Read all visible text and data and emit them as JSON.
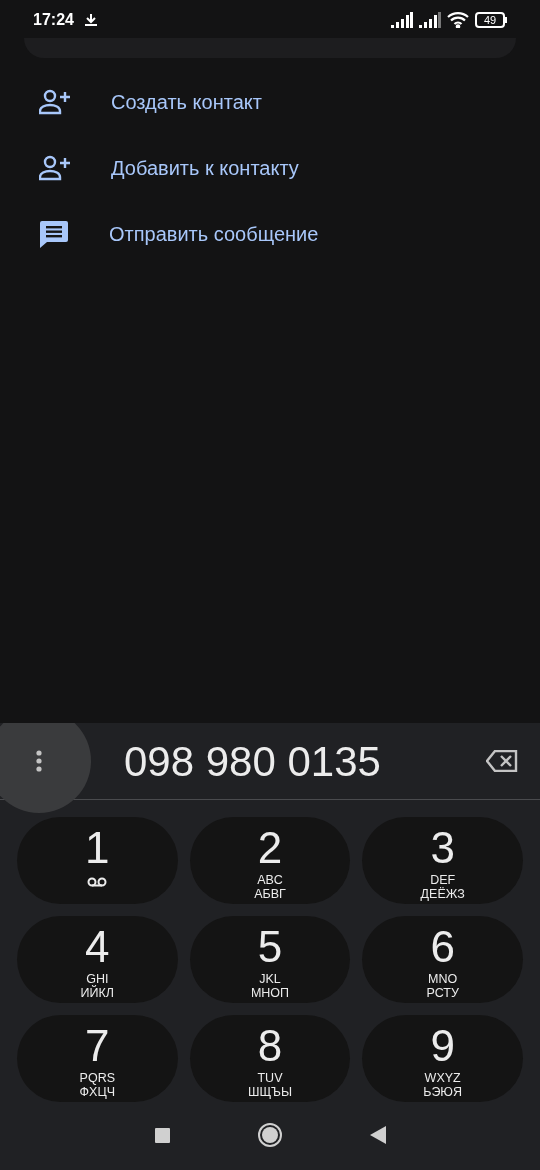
{
  "status_bar": {
    "time": "17:24",
    "battery": "49"
  },
  "actions": [
    {
      "kind": "add-person",
      "label": "Создать контакт"
    },
    {
      "kind": "add-person",
      "label": "Добавить к контакту"
    },
    {
      "kind": "message",
      "label": "Отправить сообщение"
    }
  ],
  "dialer": {
    "number": "098 980 0135",
    "keys": [
      {
        "digit": "1",
        "kind": "voicemail"
      },
      {
        "digit": "2",
        "kind": "letters",
        "latin": "ABC",
        "cyrillic": "АБВГ"
      },
      {
        "digit": "3",
        "kind": "letters",
        "latin": "DEF",
        "cyrillic": "ДЕЁЖЗ"
      },
      {
        "digit": "4",
        "kind": "letters",
        "latin": "GHI",
        "cyrillic": "ИЙКЛ"
      },
      {
        "digit": "5",
        "kind": "letters",
        "latin": "JKL",
        "cyrillic": "МНОП"
      },
      {
        "digit": "6",
        "kind": "letters",
        "latin": "MNO",
        "cyrillic": "РСТУ"
      },
      {
        "digit": "7",
        "kind": "letters",
        "latin": "PQRS",
        "cyrillic": "ФХЦЧ"
      },
      {
        "digit": "8",
        "kind": "letters",
        "latin": "TUV",
        "cyrillic": "ШЩЪЫ"
      },
      {
        "digit": "9",
        "kind": "letters",
        "latin": "WXYZ",
        "cyrillic": "ЬЭЮЯ"
      }
    ]
  }
}
